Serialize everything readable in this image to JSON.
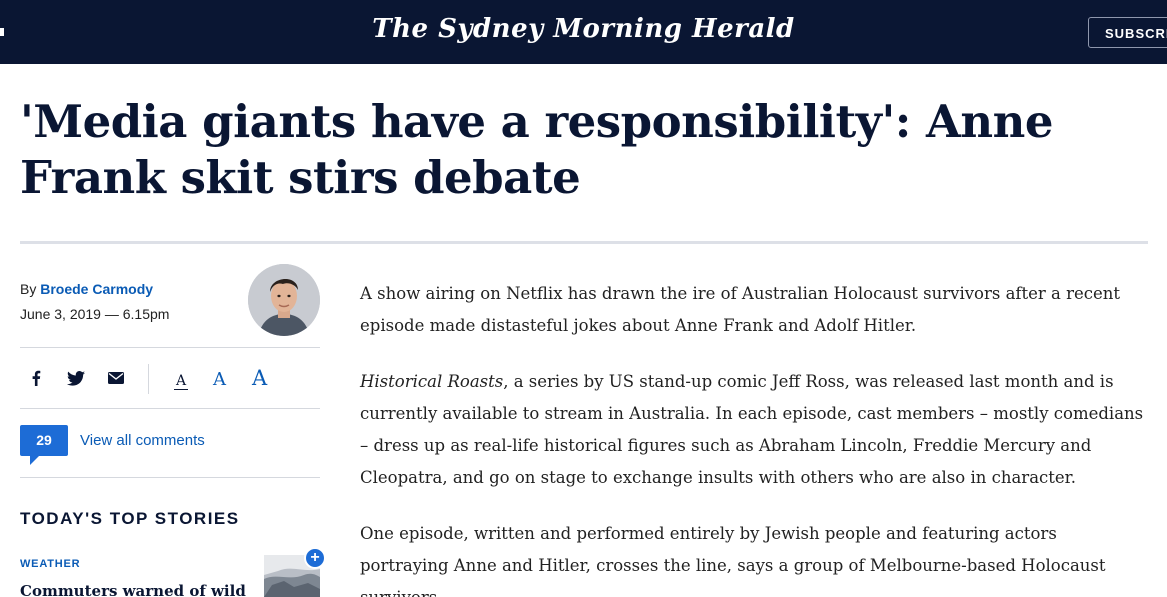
{
  "header": {
    "masthead": "The Sydney Morning Herald",
    "subscribe_label": "SUBSCRIBE"
  },
  "article": {
    "headline": "'Media giants have a responsibility': Anne Frank skit stirs debate",
    "byline_prefix": "By",
    "author": "Broede Carmody",
    "date": "June 3, 2019 — 6.15pm",
    "paragraphs": [
      "A show airing on Netflix has drawn the ire of Australian Holocaust survivors after a recent episode made distasteful jokes about Anne Frank and Adolf Hitler.",
      "Historical Roasts",
      ", a series by US stand-up comic Jeff Ross, was released last month and is currently available to stream in Australia. In each episode, cast members – mostly comedians – dress up as real-life historical figures such as Abraham Lincoln, Freddie Mercury and Cleopatra, and go on stage to exchange insults with others who are also in character.",
      "One episode, written and performed entirely by Jewish people and featuring actors portraying Anne and Hitler, crosses the line, says a group of Melbourne-based Holocaust survivors."
    ]
  },
  "share": {
    "icons": [
      "facebook-icon",
      "twitter-icon",
      "email-icon"
    ],
    "text_size_labels": [
      "A",
      "A",
      "A"
    ]
  },
  "comments": {
    "count": "29",
    "link_label": "View all comments"
  },
  "sidebar": {
    "heading": "TODAY'S TOP STORIES",
    "story": {
      "tag": "WEATHER",
      "title": "Commuters warned of wild trip",
      "add_label": "+"
    }
  },
  "colors": {
    "navy": "#0a1633",
    "link_blue": "#0a5bb5",
    "badge_blue": "#1d6cd6"
  }
}
